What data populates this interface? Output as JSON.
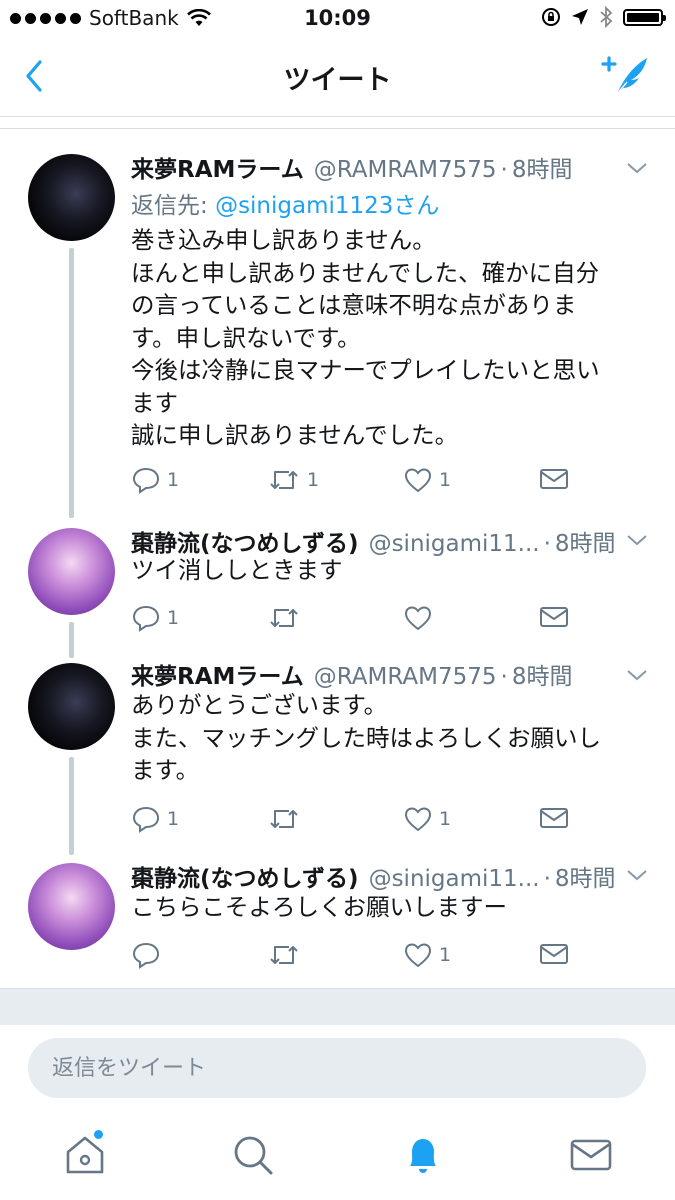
{
  "status_bar": {
    "carrier": "SoftBank",
    "time": "10:09"
  },
  "nav": {
    "title": "ツイート"
  },
  "tweets": [
    {
      "name": "来夢RAMラーム",
      "handle": "@RAMRAM7575",
      "dot": "·",
      "time": "8時間",
      "reply_to_label": "返信先:",
      "reply_to_mention": "@sinigami1123さん",
      "lines": [
        "巻き込み申し訳ありません。",
        "ほんと申し訳ありませんでした、確かに自分",
        "の言っていることは意味不明な点がありま",
        "す。申し訳ないです。",
        "今後は冷静に良マナーでプレイしたいと思い",
        "ます",
        "誠に申し訳ありませんでした。"
      ],
      "replies": "1",
      "retweets": "1",
      "likes": "1"
    },
    {
      "name": "棗静流(なつめしずる)",
      "handle": "@sinigami11...",
      "dot": "·",
      "time": "8時間",
      "lines": [
        "ツイ消ししときます"
      ],
      "replies": "1",
      "retweets": "",
      "likes": ""
    },
    {
      "name": "来夢RAMラーム",
      "handle": "@RAMRAM7575",
      "dot": "·",
      "time": "8時間",
      "lines": [
        "ありがとうございます。",
        "また、マッチングした時はよろしくお願いし",
        "ます。"
      ],
      "replies": "1",
      "retweets": "",
      "likes": "1"
    },
    {
      "name": "棗静流(なつめしずる)",
      "handle": "@sinigami11...",
      "dot": "·",
      "time": "8時間",
      "lines": [
        "こちらこそよろしくお願いしますー"
      ],
      "replies": "",
      "retweets": "",
      "likes": "1"
    }
  ],
  "reply_box": {
    "placeholder": "返信をツイート"
  },
  "colors": {
    "accent": "#1da1f2",
    "secondary_text": "#657786",
    "divider": "#e6ecf0",
    "thread_line": "#c4cfd6"
  },
  "icons": {
    "back": "chevron-left-icon",
    "compose": "compose-tweet-icon",
    "reply": "reply-icon",
    "retweet": "retweet-icon",
    "like": "heart-icon",
    "dm": "envelope-icon",
    "home": "home-icon",
    "search": "search-icon",
    "notifications": "bell-icon",
    "messages": "envelope-icon"
  }
}
